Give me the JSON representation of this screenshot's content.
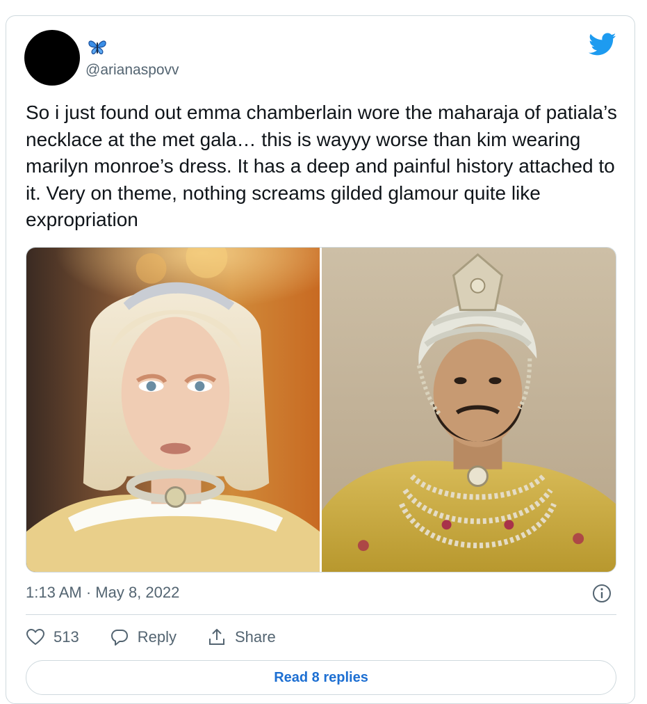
{
  "tweet": {
    "display_name_emoji": "butterfly-emoji",
    "handle": "@arianaspovv",
    "text": "So i just found out emma chamberlain wore the maharaja of patiala’s necklace at the met gala… this is wayyy worse than kim wearing marilyn monroe’s dress. It has a deep and painful history attached to it. Very on theme, nothing screams gilded glamour quite like expropriation",
    "timestamp": "1:13 AM · May 8, 2022",
    "likes": "513",
    "reply_label": "Reply",
    "share_label": "Share",
    "read_replies_label": "Read 8 replies"
  },
  "icons": {
    "brand": "twitter-bird-icon",
    "info": "info-icon",
    "like": "heart-icon",
    "reply": "speech-bubble-icon",
    "share": "share-upload-icon"
  },
  "colors": {
    "twitter_blue": "#1d9bf0",
    "link_blue": "#1d6fd2",
    "secondary_text": "#536471",
    "border": "#cfd9de"
  }
}
